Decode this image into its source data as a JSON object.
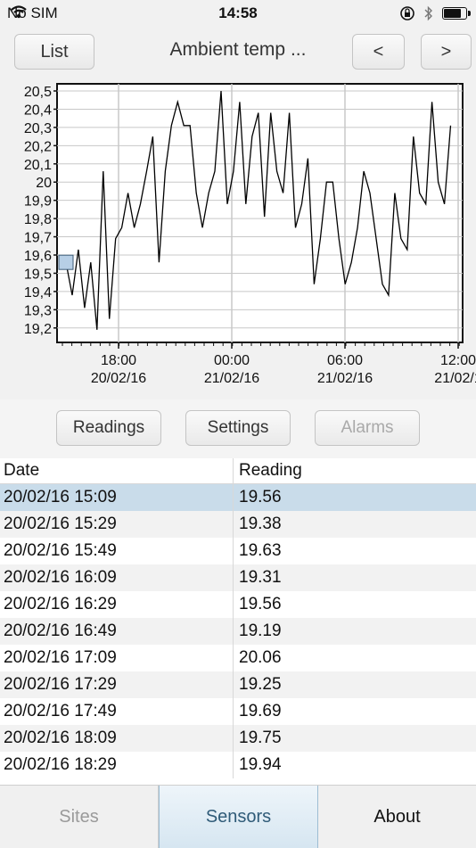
{
  "status": {
    "carrier": "No SIM",
    "time": "14:58"
  },
  "header": {
    "list_label": "List",
    "title": "Ambient temp ...",
    "prev_label": "<",
    "next_label": ">"
  },
  "chart_data": {
    "type": "line",
    "title": "",
    "xlabel": "",
    "ylabel": "",
    "ylim": [
      19.15,
      20.5
    ],
    "y_ticks": [
      "20,5",
      "20,4",
      "20,3",
      "20,2",
      "20,1",
      "20",
      "19,9",
      "19,8",
      "19,7",
      "19,6",
      "19,5",
      "19,4",
      "19,3",
      "19,2"
    ],
    "x_tick_labels": [
      {
        "time": "18:00",
        "date": "20/02/16"
      },
      {
        "time": "00:00",
        "date": "21/02/16"
      },
      {
        "time": "06:00",
        "date": "21/02/16"
      },
      {
        "time": "12:00",
        "date": "21/02/1"
      }
    ],
    "grid": true,
    "series": [
      {
        "color": "#000000",
        "values": [
          19.56,
          19.38,
          19.63,
          19.31,
          19.56,
          19.19,
          20.06,
          19.25,
          19.69,
          19.75,
          19.94,
          19.75,
          19.88,
          20.06,
          20.25,
          19.56,
          20.06,
          20.31,
          20.44,
          20.31,
          20.31,
          19.94,
          19.75,
          19.94,
          20.06,
          20.5,
          19.88,
          20.06,
          20.44,
          19.88,
          20.25,
          20.38,
          19.81,
          20.38,
          20.06,
          19.94,
          20.38,
          19.75,
          19.88,
          20.13,
          19.44,
          19.69,
          20.0,
          20.0,
          19.69,
          19.44,
          19.56,
          19.75,
          20.06,
          19.94,
          19.69,
          19.44,
          19.38,
          19.94,
          19.69,
          19.63,
          20.25,
          19.94,
          19.88,
          20.44,
          20.0,
          19.88,
          20.31
        ]
      }
    ]
  },
  "subtabs": {
    "readings": "Readings",
    "settings": "Settings",
    "alarms": "Alarms"
  },
  "table": {
    "headers": {
      "date": "Date",
      "reading": "Reading"
    },
    "rows": [
      {
        "date": "20/02/16 15:09",
        "reading": "19.56"
      },
      {
        "date": "20/02/16 15:29",
        "reading": "19.38"
      },
      {
        "date": "20/02/16 15:49",
        "reading": "19.63"
      },
      {
        "date": "20/02/16 16:09",
        "reading": "19.31"
      },
      {
        "date": "20/02/16 16:29",
        "reading": "19.56"
      },
      {
        "date": "20/02/16 16:49",
        "reading": "19.19"
      },
      {
        "date": "20/02/16 17:09",
        "reading": "20.06"
      },
      {
        "date": "20/02/16 17:29",
        "reading": "19.25"
      },
      {
        "date": "20/02/16 17:49",
        "reading": "19.69"
      },
      {
        "date": "20/02/16 18:09",
        "reading": "19.75"
      },
      {
        "date": "20/02/16 18:29",
        "reading": "19.94"
      }
    ]
  },
  "bottom_tabs": {
    "sites": "Sites",
    "sensors": "Sensors",
    "about": "About"
  },
  "colors": {
    "selected_row": "#c9dcea",
    "active_tab_text": "#2f5b78"
  }
}
